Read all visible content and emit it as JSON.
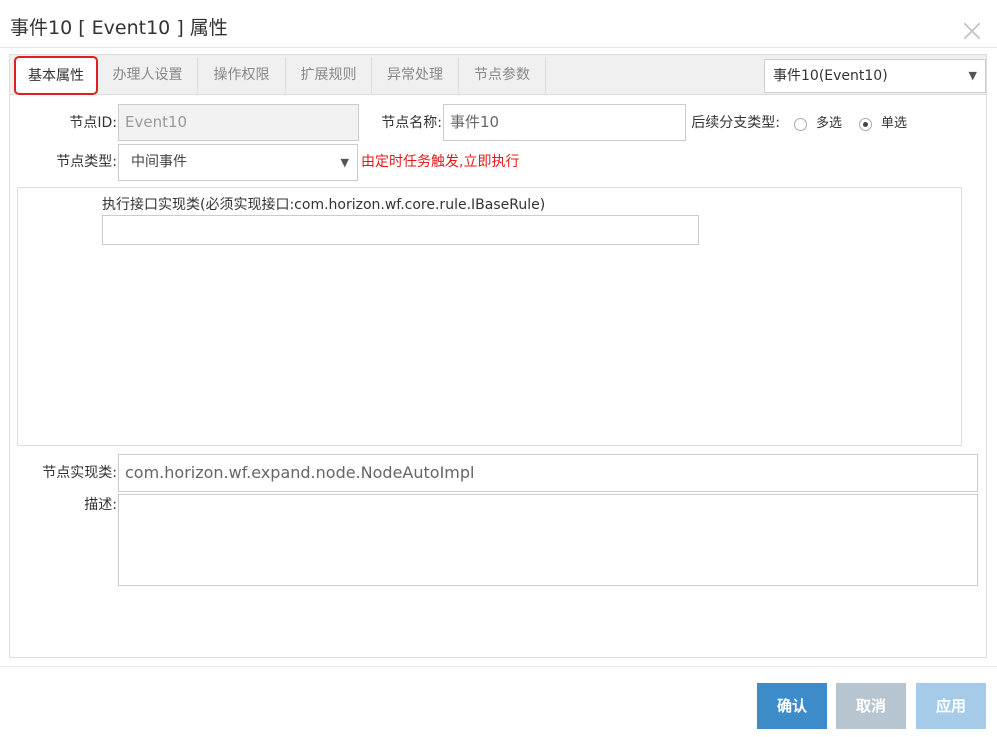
{
  "dialog": {
    "title": "事件10 [ Event10 ] 属性"
  },
  "tabs": [
    {
      "label": "基本属性",
      "active": true
    },
    {
      "label": "办理人设置",
      "active": false
    },
    {
      "label": "操作权限",
      "active": false
    },
    {
      "label": "扩展规则",
      "active": false
    },
    {
      "label": "异常处理",
      "active": false
    },
    {
      "label": "节点参数",
      "active": false
    }
  ],
  "node_selector": {
    "value": "事件10(Event10)"
  },
  "form": {
    "node_id": {
      "label": "节点ID:",
      "value": "Event10"
    },
    "node_name": {
      "label": "节点名称:",
      "value": "事件10"
    },
    "branch_type": {
      "label": "后续分支类型:",
      "options": [
        {
          "label": "多选",
          "checked": false
        },
        {
          "label": "单选",
          "checked": true
        }
      ]
    },
    "node_type": {
      "label": "节点类型:",
      "value": "中间事件",
      "hint": "由定时任务触发,立即执行"
    },
    "impl_interface": {
      "label": "执行接口实现类(必须实现接口:com.horizon.wf.core.rule.IBaseRule)",
      "value": ""
    },
    "node_impl": {
      "label": "节点实现类:",
      "value": "com.horizon.wf.expand.node.NodeAutoImpl"
    },
    "description": {
      "label": "描述:",
      "value": ""
    }
  },
  "footer": {
    "confirm_label": "确认",
    "cancel_label": "取消",
    "apply_label": "应用"
  },
  "colors": {
    "primary": "#3d8bc9",
    "cancel": "#b7c5d0",
    "apply_disabled": "#a6cbe9",
    "hint_red": "#e81818",
    "highlight_red": "#e02020"
  }
}
